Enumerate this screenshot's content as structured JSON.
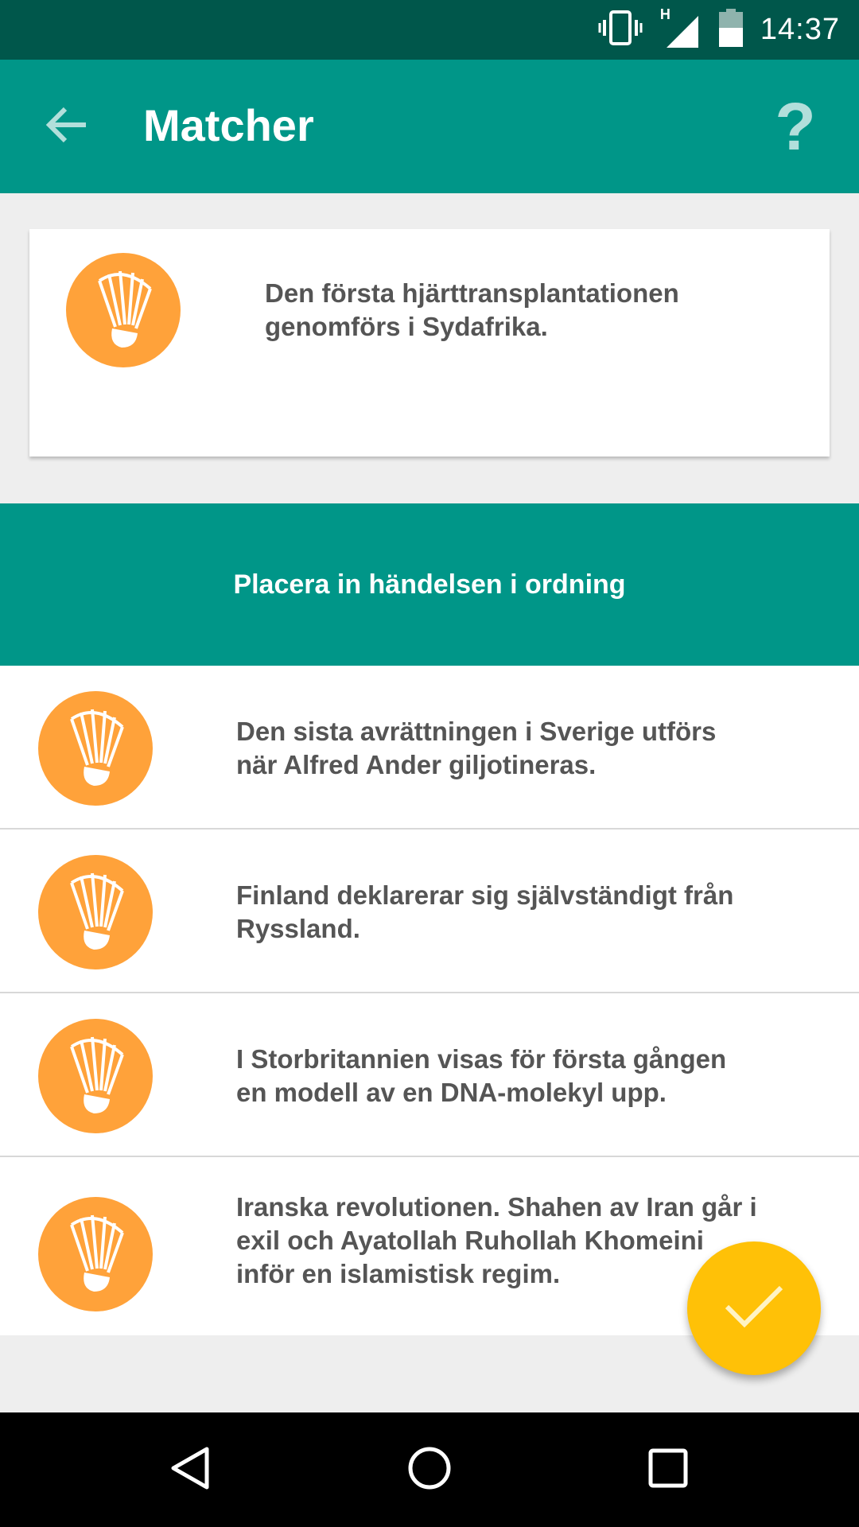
{
  "status_bar": {
    "time": "14:37",
    "network_type": "H",
    "icons": [
      "vibrate-icon",
      "signal-icon",
      "battery-icon"
    ]
  },
  "app_bar": {
    "title": "Matcher",
    "help_label": "?",
    "back_icon": "arrow-left-icon"
  },
  "event_card": {
    "text": "Den första hjärttransplantationen genomförs i Sydafrika.",
    "icon": "shuttlecock-icon"
  },
  "instruction": "Placera in händelsen i ordning",
  "events": [
    {
      "text": "Den sista avrättningen i Sverige utförs när Alfred Ander giljotineras."
    },
    {
      "text": "Finland deklarerar sig självständigt från Ryssland."
    },
    {
      "text": "I Storbritannien visas för första gången en modell av en DNA-molekyl upp."
    },
    {
      "text": "Iranska revolutionen. Shahen av Iran går i exil och Ayatollah Ruhollah Khomeini inför en islamistisk regim."
    }
  ],
  "fab_icon": "checkmark-icon",
  "colors": {
    "primary": "#009688",
    "primary_dark": "#00574b",
    "badge": "#ffa23a",
    "fab": "#ffc107"
  }
}
